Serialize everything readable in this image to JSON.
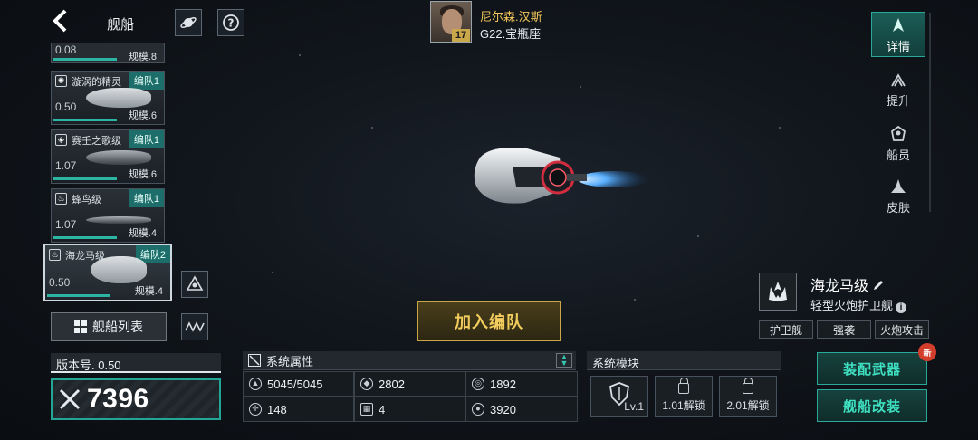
{
  "nav": {
    "title": "舰船"
  },
  "commander": {
    "name": "尼尔森.汉斯",
    "level": "17",
    "location": "G22.宝瓶座"
  },
  "ship_list": [
    {
      "name": "",
      "fleet": "",
      "value": "0.08",
      "scale": "规模.8"
    },
    {
      "name": "漩涡的精灵",
      "fleet": "编队1",
      "value": "0.50",
      "scale": "规模.6"
    },
    {
      "name": "赛壬之歌级",
      "fleet": "编队1",
      "value": "1.07",
      "scale": "规模.6"
    },
    {
      "name": "蜂鸟级",
      "fleet": "编队1",
      "value": "1.07",
      "scale": "规模.4"
    },
    {
      "name": "海龙马级",
      "fleet": "编队2",
      "value": "0.50",
      "scale": "规模.4"
    }
  ],
  "shiplist_button": "舰船列表",
  "version": {
    "label": "版本号. 0.50"
  },
  "power": {
    "value": "7396"
  },
  "join_button": "加入编队",
  "attributes": {
    "title": "系统属性",
    "cells": [
      "5045/5045",
      "2802",
      "1892",
      "148",
      "4",
      "3920"
    ]
  },
  "modules": {
    "title": "系统模块",
    "slot1": "Lv.1",
    "slot2": "1.01解锁",
    "slot3": "2.01解锁"
  },
  "tabs": [
    "详情",
    "提升",
    "船员",
    "皮肤"
  ],
  "ship_info": {
    "name": "海龙马级",
    "class": "轻型火炮护卫舰",
    "tags": [
      "护卫舰",
      "强袭",
      "火炮攻击"
    ]
  },
  "buttons": {
    "equip_weapons": "装配武器",
    "modify_ship": "舰船改装",
    "new_badge": "新"
  },
  "colors": {
    "accent_teal": "#2aa99a",
    "gold": "#f2cd5d",
    "commander_name": "#f3c75a",
    "badge_red": "#d33d2c"
  }
}
